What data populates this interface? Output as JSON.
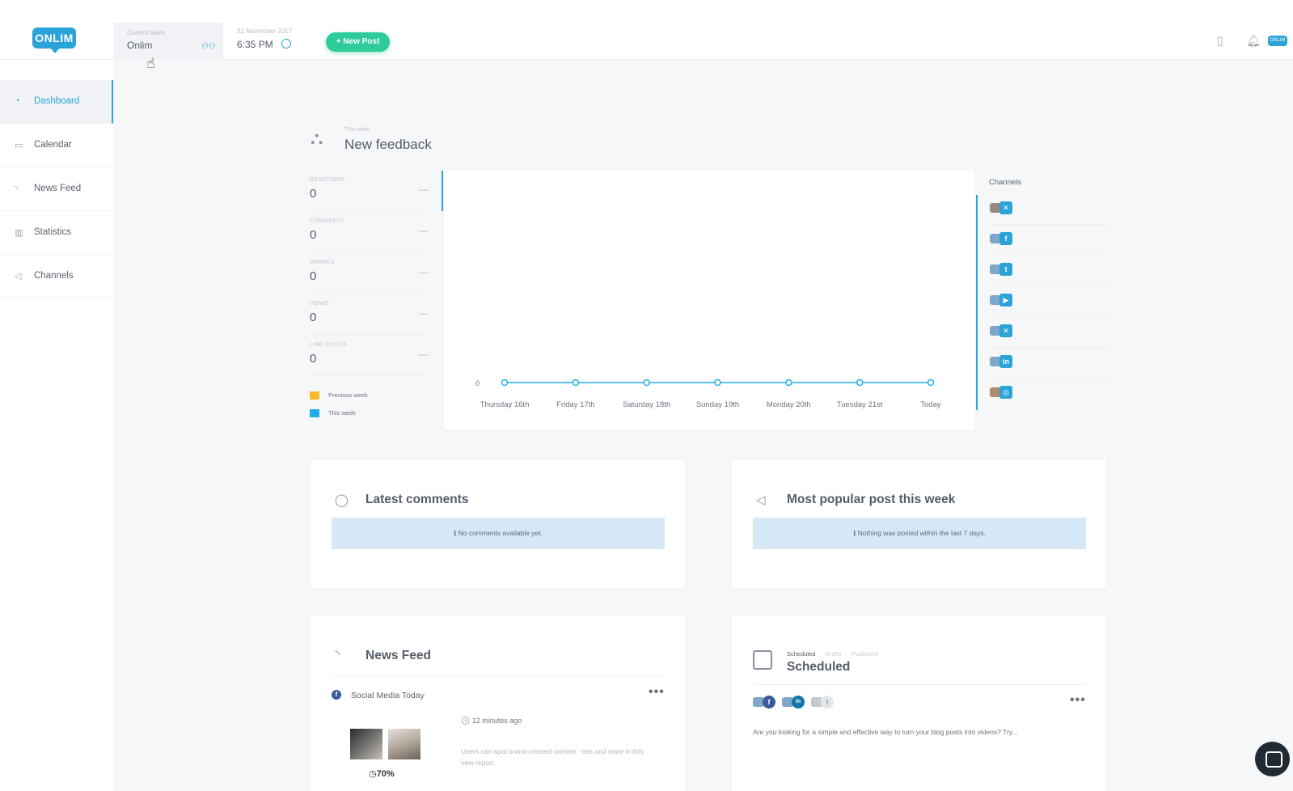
{
  "header": {
    "logo_text": "ONLIM",
    "team_label": "Current team",
    "team_value": "Onlim",
    "date_label": "22 November 2017",
    "time_value": "6:35 PM",
    "new_post_label": "+ New Post"
  },
  "sidebar": {
    "items": [
      {
        "label": "Dashboard",
        "icon": "dashboard-icon"
      },
      {
        "label": "Calendar",
        "icon": "calendar-icon"
      },
      {
        "label": "News Feed",
        "icon": "rss-icon"
      },
      {
        "label": "Statistics",
        "icon": "chart-icon"
      },
      {
        "label": "Channels",
        "icon": "megaphone-icon"
      }
    ]
  },
  "feedback": {
    "subtitle": "This week",
    "title": "New feedback",
    "metrics": [
      {
        "key": "REACTIONS",
        "value": "0"
      },
      {
        "key": "COMMENTS",
        "value": "0"
      },
      {
        "key": "SHARES",
        "value": "0"
      },
      {
        "key": "VIEWS",
        "value": "0"
      },
      {
        "key": "LINK CLICKS",
        "value": "0"
      }
    ],
    "legend": {
      "previous": "Previous week",
      "current": "This week"
    },
    "legend_colors": {
      "previous": "#f7b928",
      "current": "#22aee4"
    },
    "channels_label": "Channels",
    "channels": [
      {
        "badge": "✕"
      },
      {
        "badge": "f"
      },
      {
        "badge": "t"
      },
      {
        "badge": "▶"
      },
      {
        "badge": "✕"
      },
      {
        "badge": "in"
      },
      {
        "badge": "◎"
      }
    ]
  },
  "chart_data": {
    "type": "line",
    "categories": [
      "Thursday 16th",
      "Friday 17th",
      "Saturday 18th",
      "Sunday 19th",
      "Monday 20th",
      "Tuesday 21st",
      "Today"
    ],
    "series": [
      {
        "name": "This week",
        "values": [
          0,
          0,
          0,
          0,
          0,
          0,
          0
        ],
        "color": "#22aee4"
      }
    ],
    "y_tick": "0",
    "title": "",
    "xlabel": "",
    "ylabel": ""
  },
  "latest_comments": {
    "title": "Latest comments",
    "info": "ℹ No comments available yet."
  },
  "most_popular": {
    "title": "Most popular post this week",
    "info": "ℹ Nothing was posted within the last 7 days."
  },
  "news_feed": {
    "title": "News Feed",
    "source": "Social Media Today",
    "time": "🕓 12 minutes ago",
    "text": "Users can spot brand-created content - this and more in this new report.",
    "badge": "◷70%"
  },
  "scheduled": {
    "tabs": [
      "Scheduled",
      "Drafts",
      "Published"
    ],
    "title": "Scheduled",
    "text": "Are you looking for a simple and effective way to turn your blog posts into videos? Try..."
  }
}
